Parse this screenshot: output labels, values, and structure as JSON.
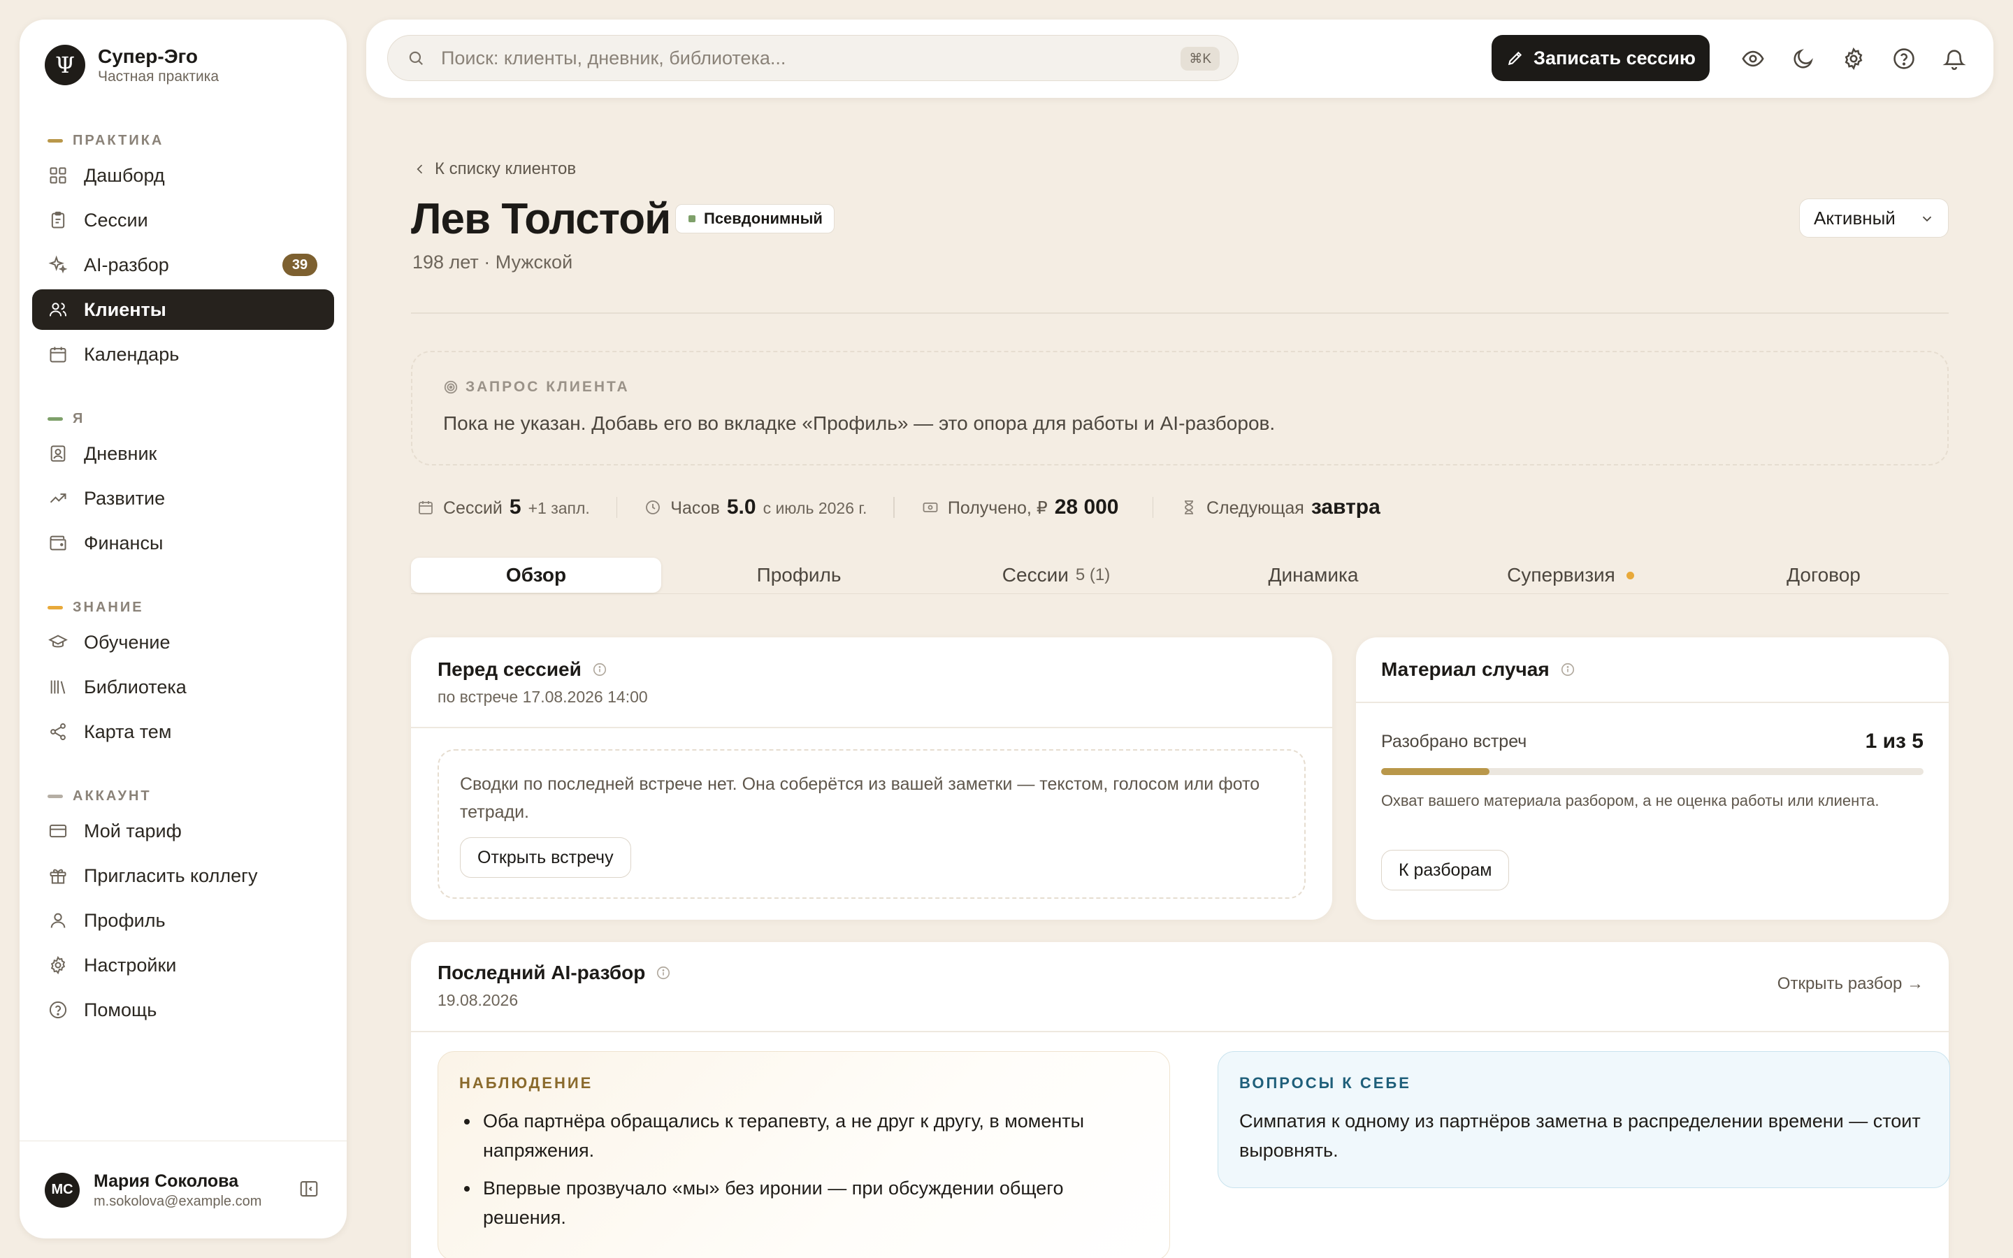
{
  "brand": {
    "logo": "Ψ",
    "name": "Супер-Эго",
    "subtitle": "Частная практика"
  },
  "sidebar": {
    "sections": [
      {
        "label": "ПРАКТИКА",
        "color": "#b9974a"
      },
      {
        "label": "Я",
        "color": "#7ea06a"
      },
      {
        "label": "ЗНАНИЕ",
        "color": "#e8a93a"
      },
      {
        "label": "АККАУНТ",
        "color": "#b5aea4"
      }
    ],
    "items": [
      {
        "label": "Дашборд",
        "icon": "grid-icon"
      },
      {
        "label": "Сессии",
        "icon": "clipboard-icon"
      },
      {
        "label": "AI-разбор",
        "icon": "sparkles-icon",
        "badge": "39"
      },
      {
        "label": "Клиенты",
        "icon": "users-icon",
        "active": true
      },
      {
        "label": "Календарь",
        "icon": "calendar-icon"
      },
      {
        "label": "Дневник",
        "icon": "journal-icon"
      },
      {
        "label": "Развитие",
        "icon": "trending-up-icon"
      },
      {
        "label": "Финансы",
        "icon": "wallet-icon"
      },
      {
        "label": "Обучение",
        "icon": "graduation-cap-icon"
      },
      {
        "label": "Библиотека",
        "icon": "library-icon"
      },
      {
        "label": "Карта тем",
        "icon": "share-nodes-icon"
      },
      {
        "label": "Мой тариф",
        "icon": "credit-card-icon"
      },
      {
        "label": "Пригласить коллегу",
        "icon": "gift-icon"
      },
      {
        "label": "Профиль",
        "icon": "user-icon"
      },
      {
        "label": "Настройки",
        "icon": "gear-icon"
      },
      {
        "label": "Помощь",
        "icon": "help-circle-icon"
      }
    ]
  },
  "user": {
    "initials": "МС",
    "name": "Мария Соколова",
    "email": "m.sokolova@example.com"
  },
  "topbar": {
    "search_placeholder": "Поиск: клиенты, дневник, библиотека...",
    "search_shortcut": "⌘K",
    "record_label": "Записать сессию",
    "icons": [
      "eye-icon",
      "moon-icon",
      "gear-icon",
      "help-circle-icon",
      "bell-icon"
    ]
  },
  "client": {
    "back_label": "К списку клиентов",
    "name": "Лев Толстой",
    "badge": "Псевдонимный",
    "meta": "198 лет · Мужской",
    "status": "Активный"
  },
  "request": {
    "label": "ЗАПРОС КЛИЕНТА",
    "text": "Пока не указан. Добавь его во вкладке «Профиль» — это опора для работы и AI-разборов."
  },
  "stats": {
    "sessions": {
      "label": "Сессий",
      "value": "5",
      "sub": "+1 запл."
    },
    "hours": {
      "label": "Часов",
      "value": "5.0",
      "sub": "с июль 2026 г."
    },
    "received": {
      "label": "Получено, ₽",
      "value": "28 000"
    },
    "next": {
      "label": "Следующая",
      "value": "завтра"
    }
  },
  "tabs": [
    {
      "label": "Обзор",
      "active": true
    },
    {
      "label": "Профиль"
    },
    {
      "label": "Сессии",
      "count": "5 (1)"
    },
    {
      "label": "Динамика"
    },
    {
      "label": "Супервизия",
      "dot": true
    },
    {
      "label": "Договор"
    }
  ],
  "before_session": {
    "title": "Перед сессией",
    "subtitle": "по встрече 17.08.2026 14:00",
    "text": "Сводки по последней встрече нет. Она соберётся из вашей заметки — текстом, голосом или фото тетради.",
    "button": "Открыть встречу"
  },
  "case_material": {
    "title": "Материал случая",
    "progress_label": "Разобрано встреч",
    "progress_value": "1 из 5",
    "progress_fraction": 0.2,
    "note": "Охват вашего материала разбором, а не оценка работы или клиента.",
    "button": "К разборам"
  },
  "last_review": {
    "title": "Последний AI-разбор",
    "date": "19.08.2026",
    "open_link": "Открыть разбор →",
    "observation": {
      "label": "НАБЛЮДЕНИЕ",
      "color": "#8a6a2c",
      "items": [
        "Оба партнёра обращались к терапевту, а не друг к другу, в моменты напряжения.",
        "Впервые прозвучало «мы» без иронии — при обсуждении общего решения."
      ]
    },
    "questions": {
      "label": "ВОПРОСЫ К СЕБЕ",
      "color": "#1f5f7a",
      "text": "Симпатия к одному из партнёров заметна в распределении времени — стоит выровнять."
    }
  }
}
